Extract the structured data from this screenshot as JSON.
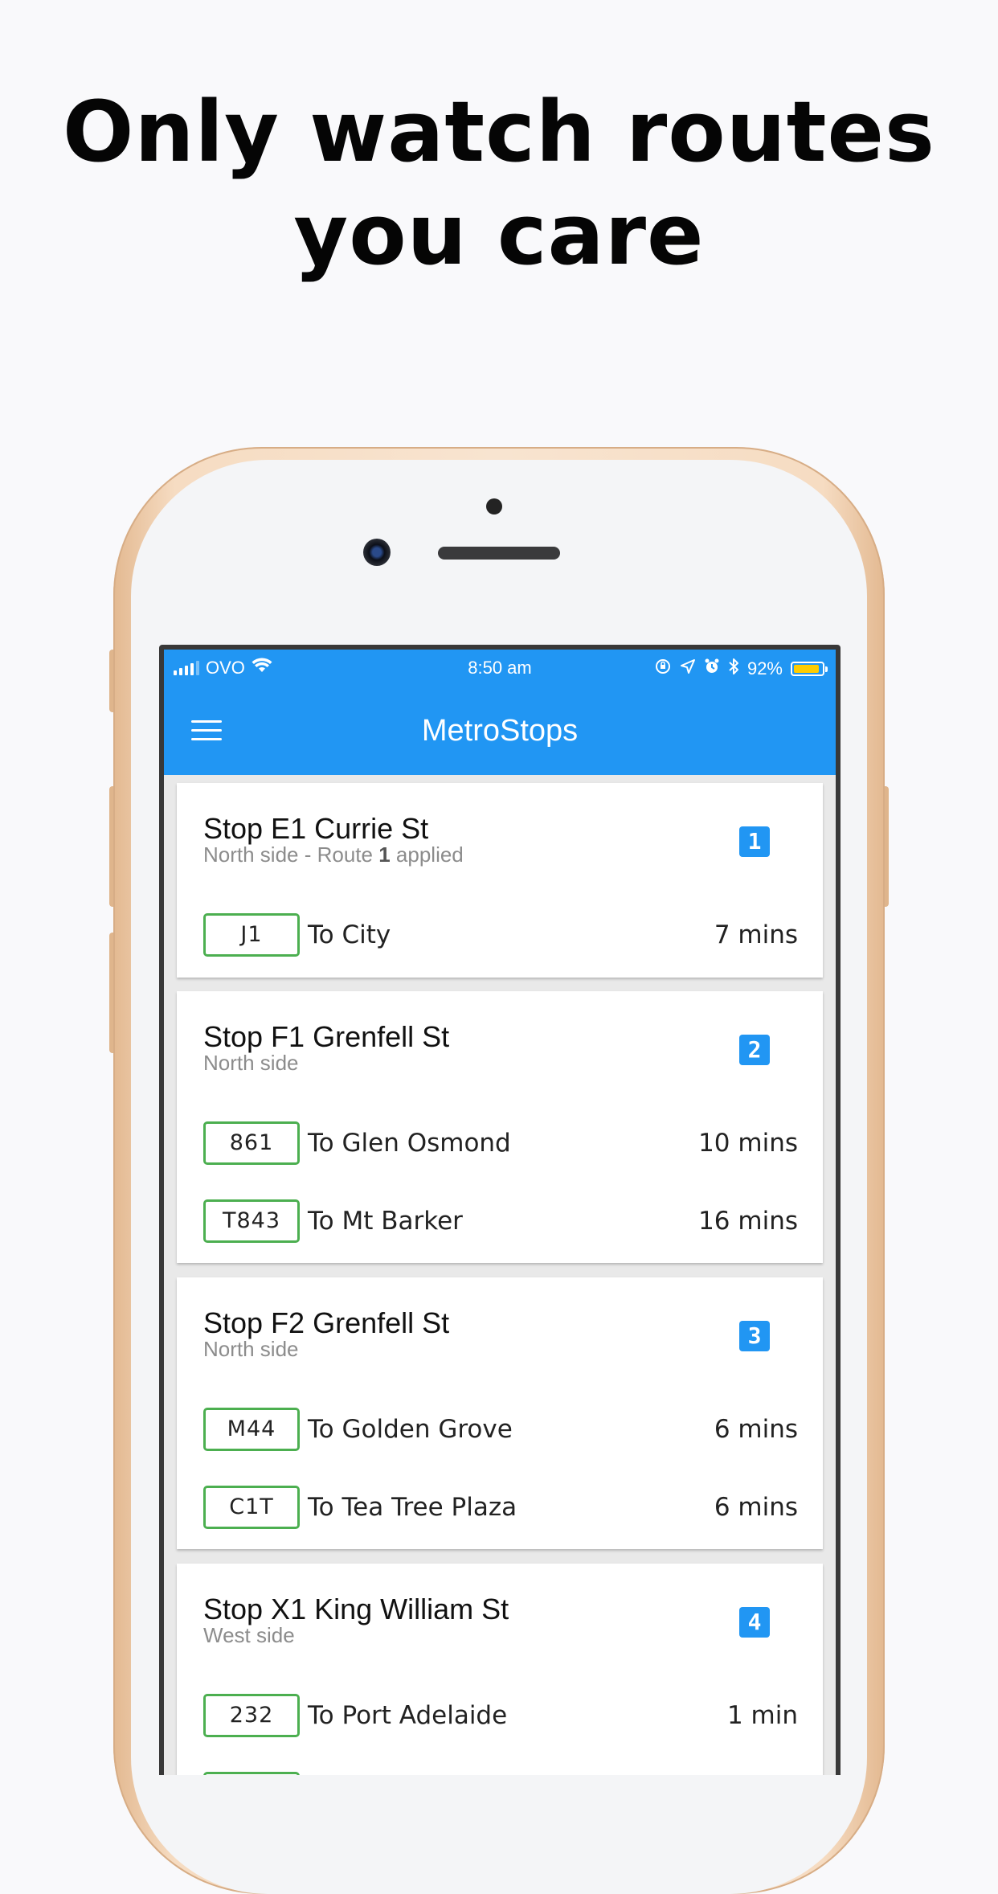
{
  "headline": {
    "line1": "Only watch routes",
    "line2": "you care"
  },
  "status_bar": {
    "carrier": "OVO",
    "time": "8:50 am",
    "battery_percent": "92%",
    "battery_level": 0.92,
    "icons": [
      "signal-icon",
      "wifi-icon",
      "orientation-lock-icon",
      "location-icon",
      "alarm-icon",
      "bluetooth-icon",
      "battery-icon"
    ]
  },
  "app": {
    "title": "MetroStops",
    "menu_icon": "hamburger-menu-icon",
    "accent": "#2196f3",
    "route_border": "#4caf50"
  },
  "stops": [
    {
      "title": "Stop E1 Currie St",
      "subtitle_prefix": "North side - Route ",
      "subtitle_bold": "1",
      "subtitle_suffix": " applied",
      "badge": "1",
      "routes": [
        {
          "code": "J1",
          "dest": "To City",
          "eta": "7 mins"
        }
      ]
    },
    {
      "title": "Stop F1 Grenfell St",
      "subtitle": "North side",
      "badge": "2",
      "routes": [
        {
          "code": "861",
          "dest": "To Glen Osmond",
          "eta": "10 mins"
        },
        {
          "code": "T843",
          "dest": "To Mt Barker",
          "eta": "16 mins"
        }
      ]
    },
    {
      "title": "Stop F2 Grenfell St",
      "subtitle": "North side",
      "badge": "3",
      "routes": [
        {
          "code": "M44",
          "dest": "To Golden Grove",
          "eta": "6 mins"
        },
        {
          "code": "C1T",
          "dest": "To Tea Tree Plaza",
          "eta": "6 mins"
        }
      ]
    },
    {
      "title": "Stop X1 King William St",
      "subtitle": "West side",
      "badge": "4",
      "routes": [
        {
          "code": "232",
          "dest": "To Port Adelaide",
          "eta": "1 min"
        }
      ]
    }
  ]
}
